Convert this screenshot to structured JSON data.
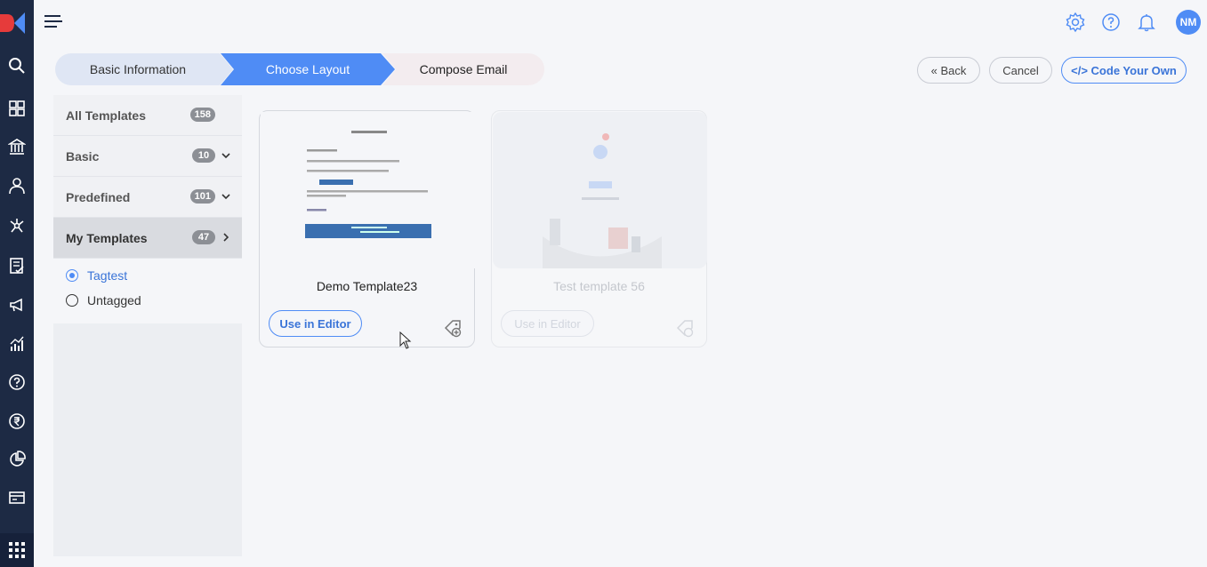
{
  "header": {
    "avatar_initials": "NM"
  },
  "icons": {
    "rail": [
      "search-icon",
      "dashboard-icon",
      "institution-icon",
      "user-icon",
      "network-icon",
      "form-icon",
      "megaphone-icon",
      "analytics-icon",
      "help-icon",
      "rupee-icon",
      "pie-chart-icon",
      "billing-icon",
      "apps-grid-icon"
    ],
    "top": [
      "settings-icon",
      "help-icon",
      "bell-icon"
    ]
  },
  "stepper": {
    "steps": [
      {
        "label": "Basic Information",
        "state": "done"
      },
      {
        "label": "Choose Layout",
        "state": "active"
      },
      {
        "label": "Compose Email",
        "state": "pending"
      }
    ]
  },
  "actions": {
    "back_label": "« Back",
    "cancel_label": "Cancel",
    "code_label": "</> Code Your Own"
  },
  "categories": [
    {
      "label": "All Templates",
      "count": "158"
    },
    {
      "label": "Basic",
      "count": "10"
    },
    {
      "label": "Predefined",
      "count": "101"
    },
    {
      "label": "My Templates",
      "count": "47"
    }
  ],
  "tags": [
    {
      "label": "Tagtest",
      "selected": true
    },
    {
      "label": "Untagged",
      "selected": false
    }
  ],
  "templates": [
    {
      "name": "Demo Template23",
      "button": "Use in Editor"
    },
    {
      "name": "Test template 56",
      "button": "Use in Editor"
    }
  ],
  "colors": {
    "accent": "#4f8cf5",
    "rail_bg": "#1d2a44",
    "brand_red": "#e63b3b"
  }
}
